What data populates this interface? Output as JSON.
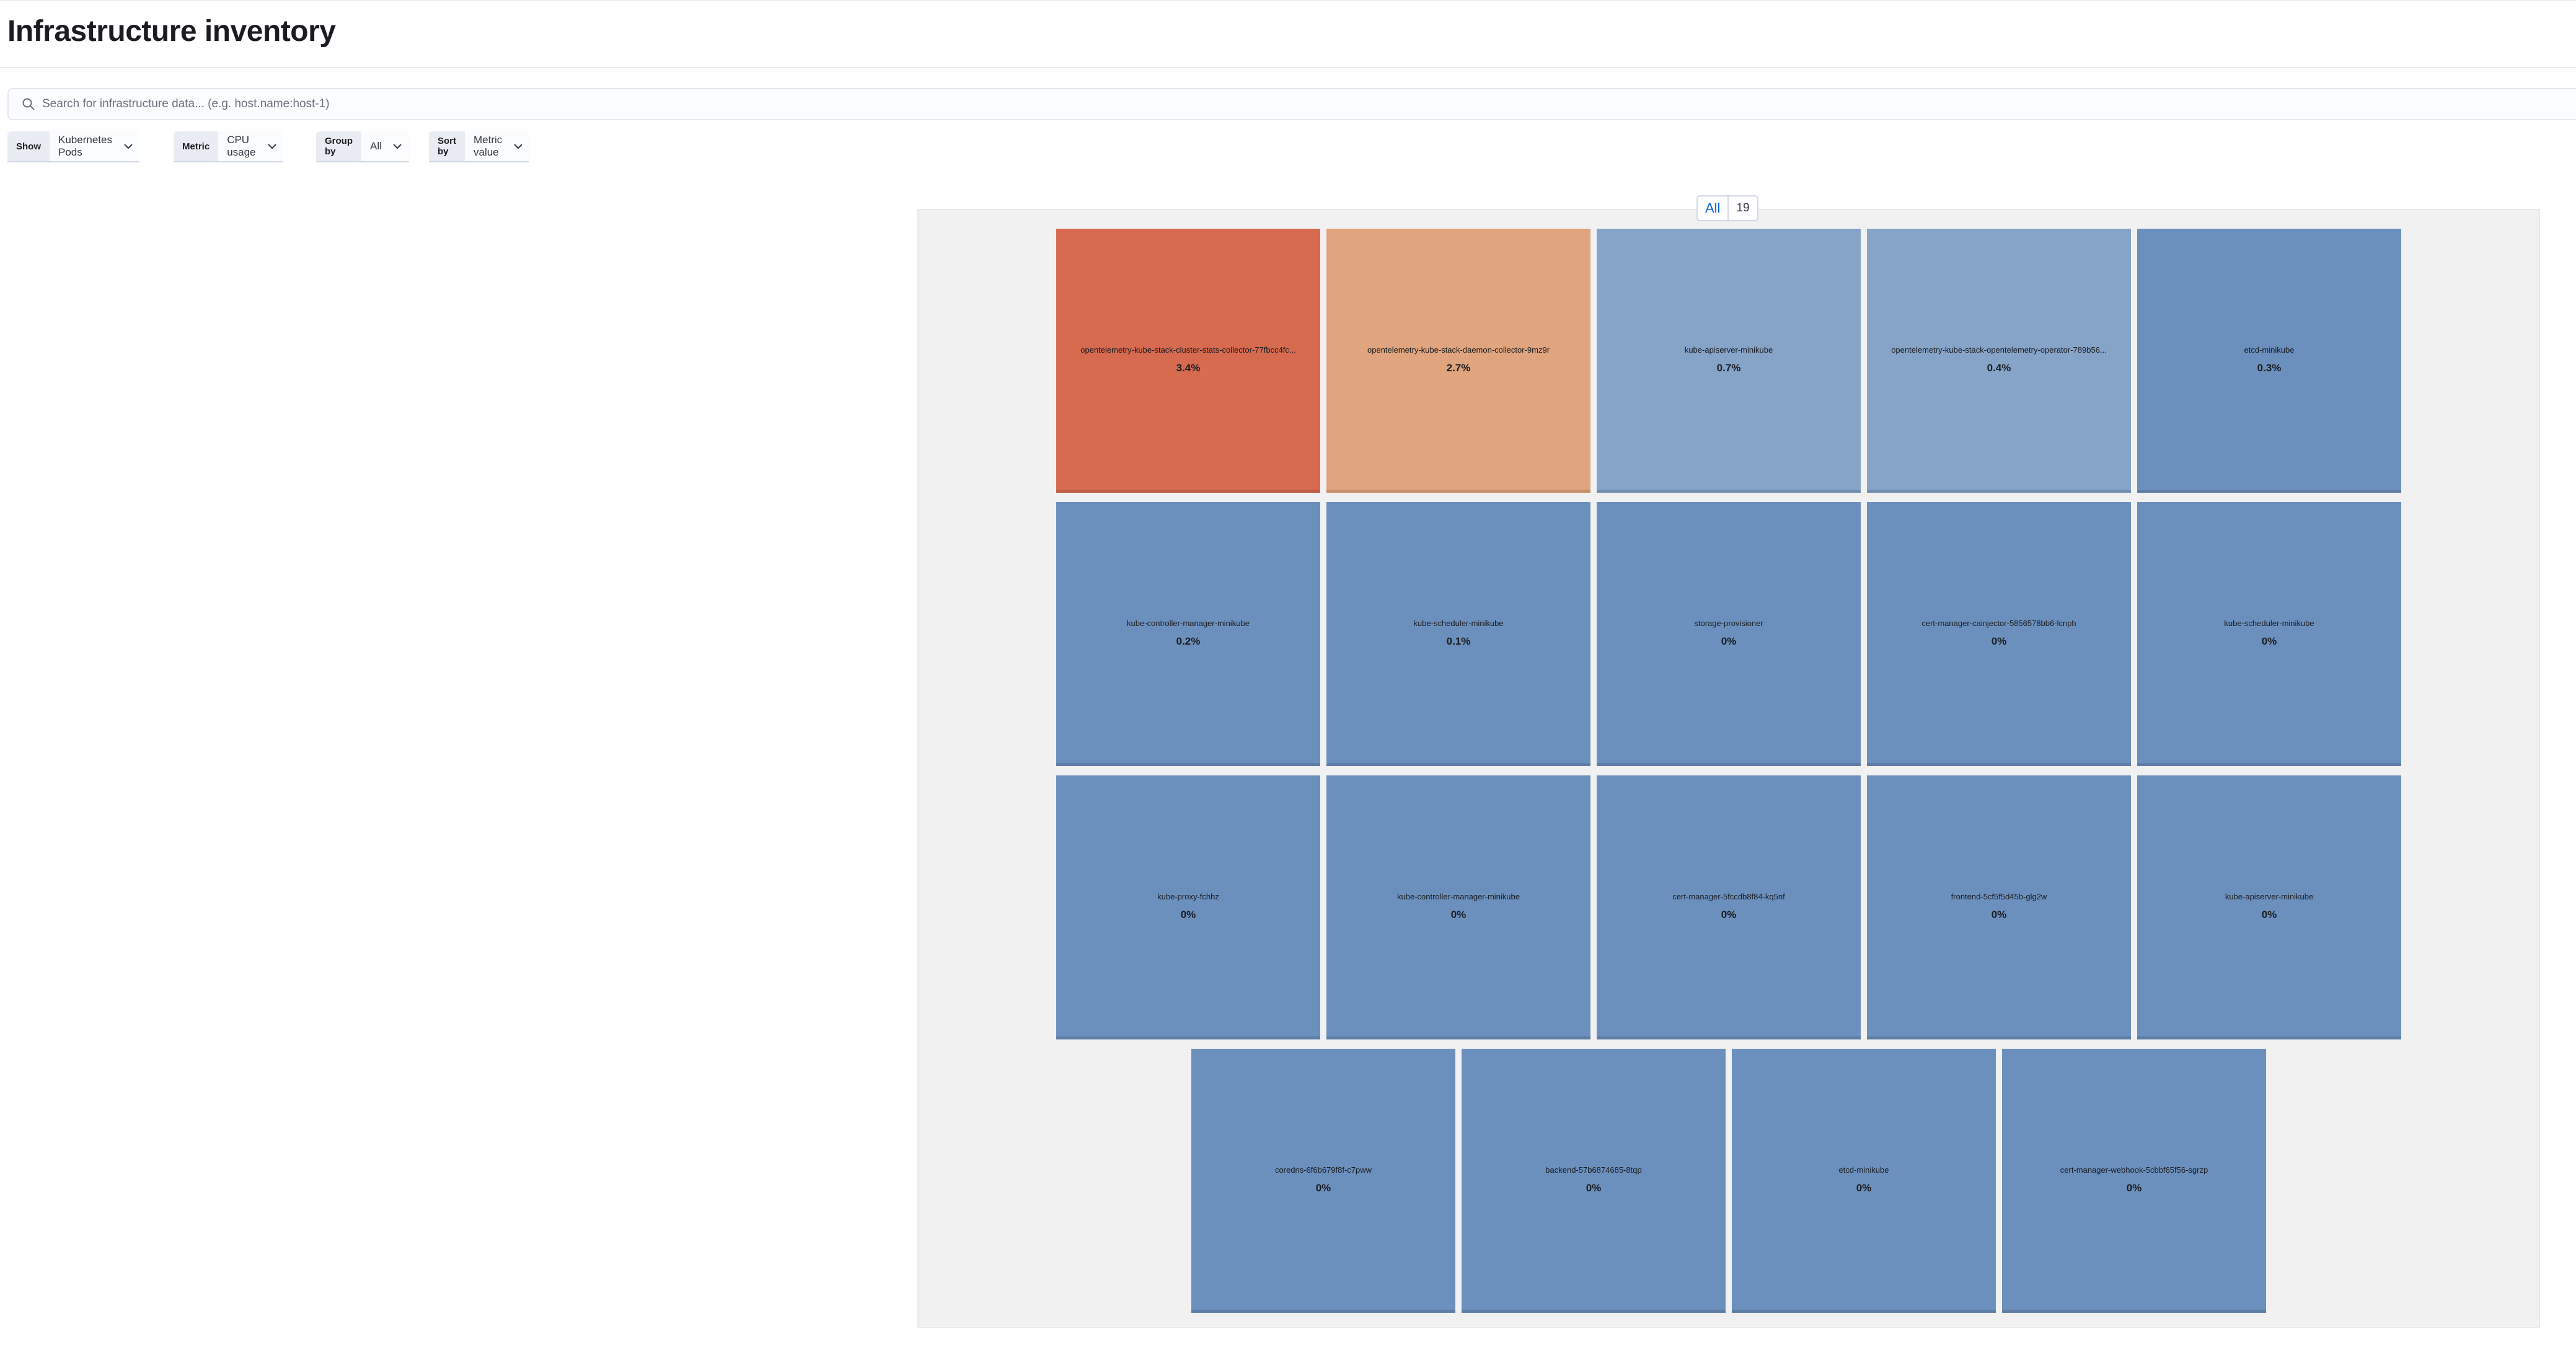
{
  "page": {
    "title": "Infrastructure inventory"
  },
  "search": {
    "placeholder": "Search for infrastructure data... (e.g. host.name:host-1)",
    "value": ""
  },
  "filters": {
    "show": {
      "label": "Show",
      "value": "Kubernetes Pods"
    },
    "metric": {
      "label": "Metric",
      "value": "CPU usage"
    },
    "group_by": {
      "label": "Group by",
      "value": "All"
    },
    "sort_by": {
      "label": "Sort by",
      "value": "Metric value"
    }
  },
  "group": {
    "name": "All",
    "count": "19"
  },
  "colors": {
    "hot": "#d66b50",
    "warm": "#e0a47e",
    "mild": "#86a3c8",
    "cool": "#6c90bd",
    "panel": "#f1f1f1",
    "accent": "#0b64dd"
  },
  "icons": {
    "search": "search-icon",
    "dropdown": "chevron-down-icon"
  },
  "tiles": [
    {
      "name": "opentelemetry-kube-stack-cluster-stats-collector-77fbcc4fc...",
      "value": "3.4%",
      "color": "#d66b50"
    },
    {
      "name": "opentelemetry-kube-stack-daemon-collector-9mz9r",
      "value": "2.7%",
      "color": "#e0a47e"
    },
    {
      "name": "kube-apiserver-minikube",
      "value": "0.7%",
      "color": "#86a3c8"
    },
    {
      "name": "opentelemetry-kube-stack-opentelemetry-operator-789b56...",
      "value": "0.4%",
      "color": "#86a3c8"
    },
    {
      "name": "etcd-minikube",
      "value": "0.3%",
      "color": "#6c90bd"
    },
    {
      "name": "kube-controller-manager-minikube",
      "value": "0.2%",
      "color": "#6c90bd"
    },
    {
      "name": "kube-scheduler-minikube",
      "value": "0.1%",
      "color": "#6c90bd"
    },
    {
      "name": "storage-provisioner",
      "value": "0%",
      "color": "#6c90bd"
    },
    {
      "name": "cert-manager-cainjector-5856578bb6-lcnph",
      "value": "0%",
      "color": "#6c90bd"
    },
    {
      "name": "kube-scheduler-minikube",
      "value": "0%",
      "color": "#6c90bd"
    },
    {
      "name": "kube-proxy-fchhz",
      "value": "0%",
      "color": "#6c90bd"
    },
    {
      "name": "kube-controller-manager-minikube",
      "value": "0%",
      "color": "#6c90bd"
    },
    {
      "name": "cert-manager-5fccdb8f84-kq5nf",
      "value": "0%",
      "color": "#6c90bd"
    },
    {
      "name": "frontend-5cf5f5d45b-glg2w",
      "value": "0%",
      "color": "#6c90bd"
    },
    {
      "name": "kube-apiserver-minikube",
      "value": "0%",
      "color": "#6c90bd"
    },
    {
      "name": "coredns-6f6b679f8f-c7pww",
      "value": "0%",
      "color": "#6c90bd"
    },
    {
      "name": "backend-57b6874685-8tqp",
      "value": "0%",
      "color": "#6c90bd"
    },
    {
      "name": "etcd-minikube",
      "value": "0%",
      "color": "#6c90bd"
    },
    {
      "name": "cert-manager-webhook-5cbbf65f56-sgrzp",
      "value": "0%",
      "color": "#6c90bd"
    }
  ]
}
